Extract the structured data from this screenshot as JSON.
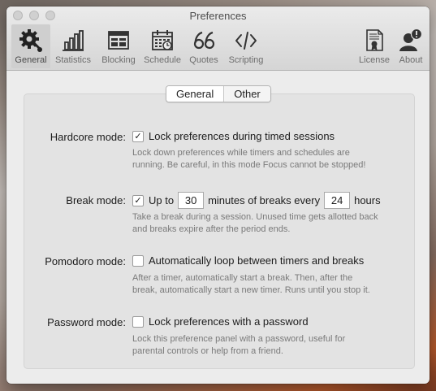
{
  "window": {
    "title": "Preferences"
  },
  "toolbar": {
    "items": [
      {
        "label": "General",
        "icon": "gear-icon",
        "active": true
      },
      {
        "label": "Statistics",
        "icon": "bar-chart-icon",
        "active": false
      },
      {
        "label": "Blocking",
        "icon": "blocking-window-icon",
        "active": false
      },
      {
        "label": "Schedule",
        "icon": "calendar-icon",
        "active": false
      },
      {
        "label": "Quotes",
        "icon": "quote-icon",
        "active": false
      },
      {
        "label": "Scripting",
        "icon": "code-icon",
        "active": false
      },
      {
        "label": "License",
        "icon": "certificate-icon",
        "active": false
      },
      {
        "label": "About",
        "icon": "person-info-icon",
        "active": false
      }
    ]
  },
  "tabs": {
    "general": "General",
    "other": "Other",
    "selected": "General"
  },
  "settings": {
    "hardcore": {
      "label": "Hardcore mode:",
      "checkbox_label": "Lock preferences during timed sessions",
      "checked": true,
      "help_1": "Lock down preferences while timers and schedules are",
      "help_2": "running. Be careful, in this mode Focus cannot be stopped!"
    },
    "break": {
      "label": "Break mode:",
      "checked": true,
      "text_1": "Up to",
      "minutes_value": "30",
      "text_2": "minutes of breaks every",
      "hours_value": "24",
      "text_3": "hours",
      "help_1": "Take a break during a session. Unused time gets allotted back",
      "help_2": "and breaks expire after the period ends."
    },
    "pomodoro": {
      "label": "Pomodoro mode:",
      "checkbox_label": "Automatically loop between timers and breaks",
      "checked": false,
      "help_1": "After a timer, automatically start a break. Then, after the",
      "help_2": "break, automatically start a new timer. Runs until you stop it."
    },
    "password": {
      "label": "Password mode:",
      "checkbox_label": "Lock preferences with a password",
      "checked": false,
      "help_1": "Lock this preference panel with a password, useful for",
      "help_2": "parental controls or help from a friend."
    }
  },
  "colors": {
    "window_bg": "#ececec",
    "panel_bg": "#e3e3e3",
    "help_text": "#7a7a7a"
  }
}
